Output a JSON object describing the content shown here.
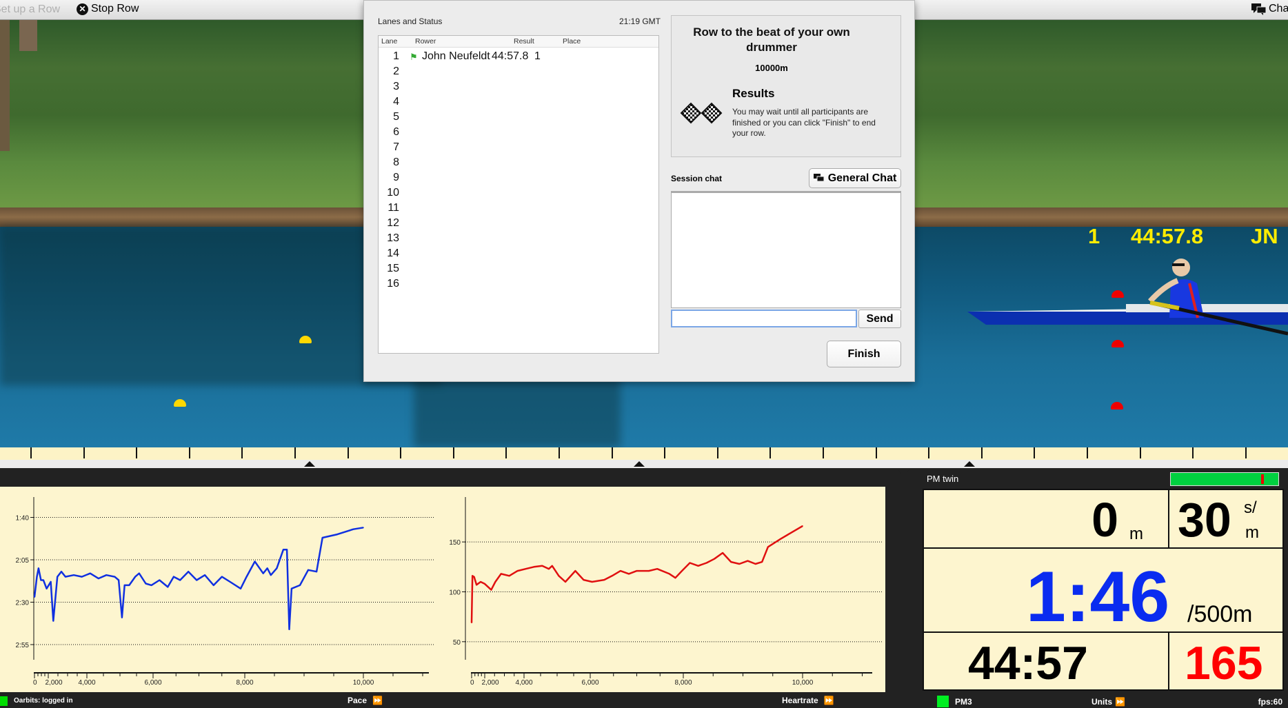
{
  "topbar": {
    "setup_label": "Set up a Row",
    "stop_label": "Stop Row",
    "chat_label": "Chat",
    "stop_icon": "x-circle-icon",
    "chat_icon": "chat-bubbles-icon"
  },
  "scene": {
    "lane": "1",
    "time": "44:57.8",
    "initials": "JN",
    "label_color": "#ffec00"
  },
  "dialog": {
    "lanes_title": "Lanes and Status",
    "clock": "21:19 GMT",
    "columns": [
      "Lane",
      "Rower",
      "Result",
      "Place"
    ],
    "rows": [
      {
        "lane": "1",
        "rower": "John Neufeldt",
        "result": "44:57.8",
        "place": "1",
        "icon": "flag-icon"
      },
      {
        "lane": "2"
      },
      {
        "lane": "3"
      },
      {
        "lane": "4"
      },
      {
        "lane": "5"
      },
      {
        "lane": "6"
      },
      {
        "lane": "7"
      },
      {
        "lane": "8"
      },
      {
        "lane": "9"
      },
      {
        "lane": "10"
      },
      {
        "lane": "11"
      },
      {
        "lane": "12"
      },
      {
        "lane": "13"
      },
      {
        "lane": "14"
      },
      {
        "lane": "15"
      },
      {
        "lane": "16"
      }
    ],
    "race_title": "Row to the beat of your own drummer",
    "distance": "10000m",
    "results_title": "Results",
    "results_text": "You may wait until all participants are finished or you can click \"Finish\" to end your row.",
    "session_chat_label": "Session chat",
    "general_chat_label": "General Chat",
    "chat_input_value": "",
    "send_label": "Send",
    "finish_label": "Finish"
  },
  "footer_left": {
    "status": "Oarbits: logged in",
    "pace_label": "Pace",
    "heartrate_label": "Heartrate",
    "status_color": "#00dd00"
  },
  "pm": {
    "title": "PM twin",
    "progress": 0.85,
    "distance_value": "0",
    "distance_unit": "m",
    "rate_value": "30",
    "rate_unit_top": "s/",
    "rate_unit_bottom": "m",
    "pace_value": "1:46",
    "pace_unit": "/500m",
    "pace_color": "#0a2cf0",
    "time_value": "44:57",
    "hr_value": "165",
    "hr_color": "#ff0000",
    "monitor": "PM3",
    "units_label": "Units",
    "fps": "fps:60"
  },
  "chart_data": [
    {
      "type": "line",
      "series_color": "#1030e0",
      "y_inverted": true,
      "ylim": [
        88,
        188
      ],
      "y_ticks": [
        {
          "v": 100,
          "label": "1:40"
        },
        {
          "v": 125,
          "label": "2:05"
        },
        {
          "v": 150,
          "label": "2:30"
        },
        {
          "v": 175,
          "label": "2:55"
        }
      ],
      "x_ticks": [
        {
          "v": 0,
          "label": "0"
        },
        {
          "v": 2000,
          "label": "2,000"
        },
        {
          "v": 4000,
          "label": "4,000"
        },
        {
          "v": 6000,
          "label": "6,000"
        },
        {
          "v": 8000,
          "label": "8,000"
        },
        {
          "v": 10000,
          "label": "10,000"
        }
      ],
      "grid": true,
      "points": [
        [
          0,
          147
        ],
        [
          350,
          135
        ],
        [
          590,
          130
        ],
        [
          940,
          137
        ],
        [
          1290,
          137
        ],
        [
          1760,
          142
        ],
        [
          2130,
          138
        ],
        [
          2260,
          161
        ],
        [
          2470,
          135
        ],
        [
          2680,
          132
        ],
        [
          2890,
          135
        ],
        [
          3320,
          134
        ],
        [
          3740,
          135
        ],
        [
          4100,
          133
        ],
        [
          4350,
          136
        ],
        [
          4590,
          134
        ],
        [
          4840,
          135
        ],
        [
          4960,
          137
        ],
        [
          5060,
          159
        ],
        [
          5140,
          140
        ],
        [
          5280,
          140
        ],
        [
          5460,
          135
        ],
        [
          5580,
          133
        ],
        [
          5780,
          139
        ],
        [
          5950,
          140
        ],
        [
          6140,
          137
        ],
        [
          6320,
          141
        ],
        [
          6450,
          135
        ],
        [
          6590,
          137
        ],
        [
          6770,
          132
        ],
        [
          6950,
          137
        ],
        [
          7130,
          134
        ],
        [
          7320,
          140
        ],
        [
          7500,
          135
        ],
        [
          7680,
          138
        ],
        [
          7910,
          142
        ],
        [
          8030,
          135
        ],
        [
          8170,
          126
        ],
        [
          8310,
          133
        ],
        [
          8380,
          130
        ],
        [
          8440,
          134
        ],
        [
          8540,
          130
        ],
        [
          8650,
          119
        ],
        [
          8710,
          119
        ],
        [
          8750,
          166
        ],
        [
          8790,
          142
        ],
        [
          8930,
          140
        ],
        [
          9070,
          131
        ],
        [
          9210,
          132
        ],
        [
          9310,
          112
        ],
        [
          9560,
          110
        ],
        [
          9830,
          107
        ],
        [
          10000,
          106
        ]
      ]
    },
    {
      "type": "line",
      "series_color": "#e01010",
      "ylim": [
        25,
        195
      ],
      "y_ticks": [
        {
          "v": 50,
          "label": "50"
        },
        {
          "v": 100,
          "label": "100"
        },
        {
          "v": 150,
          "label": "150"
        }
      ],
      "x_ticks": [
        {
          "v": 0,
          "label": "0"
        },
        {
          "v": 2000,
          "label": "2,000"
        },
        {
          "v": 4000,
          "label": "4,000"
        },
        {
          "v": 6000,
          "label": "6,000"
        },
        {
          "v": 8000,
          "label": "8,000"
        },
        {
          "v": 10000,
          "label": "10,000"
        }
      ],
      "grid": true,
      "points": [
        [
          0,
          69
        ],
        [
          130,
          116
        ],
        [
          380,
          115
        ],
        [
          750,
          107
        ],
        [
          1380,
          110
        ],
        [
          2000,
          108
        ],
        [
          2330,
          102
        ],
        [
          2540,
          110
        ],
        [
          2830,
          118
        ],
        [
          3250,
          116
        ],
        [
          3670,
          121
        ],
        [
          4050,
          123
        ],
        [
          4300,
          125
        ],
        [
          4550,
          126
        ],
        [
          4750,
          123
        ],
        [
          4850,
          126
        ],
        [
          5050,
          116
        ],
        [
          5250,
          110
        ],
        [
          5550,
          121
        ],
        [
          5800,
          112
        ],
        [
          6040,
          110
        ],
        [
          6300,
          112
        ],
        [
          6470,
          116
        ],
        [
          6650,
          121
        ],
        [
          6830,
          118
        ],
        [
          7000,
          121
        ],
        [
          7260,
          121
        ],
        [
          7440,
          123
        ],
        [
          7700,
          118
        ],
        [
          7830,
          114
        ],
        [
          7970,
          121
        ],
        [
          8110,
          129
        ],
        [
          8250,
          126
        ],
        [
          8390,
          129
        ],
        [
          8520,
          133
        ],
        [
          8660,
          139
        ],
        [
          8800,
          130
        ],
        [
          8940,
          128
        ],
        [
          9080,
          131
        ],
        [
          9210,
          128
        ],
        [
          9320,
          130
        ],
        [
          9420,
          145
        ],
        [
          9630,
          153
        ],
        [
          10000,
          166
        ]
      ]
    }
  ]
}
